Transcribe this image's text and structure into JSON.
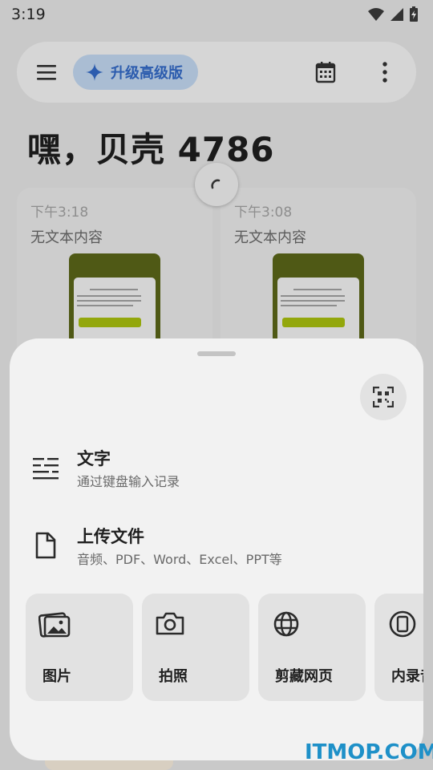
{
  "status_bar": {
    "time": "3:19"
  },
  "top_bar": {
    "upgrade_label": "升级高级版"
  },
  "greeting": "嘿，贝壳 4786",
  "cards": [
    {
      "time": "下午3:18",
      "title": "无文本内容"
    },
    {
      "time": "下午3:08",
      "title": "无文本内容"
    }
  ],
  "sheet": {
    "options": [
      {
        "title": "文字",
        "subtitle": "通过键盘输入记录",
        "icon": "text-lines-icon"
      },
      {
        "title": "上传文件",
        "subtitle": "音频、PDF、Word、Excel、PPT等",
        "icon": "file-icon"
      }
    ],
    "tiles": [
      {
        "label": "图片",
        "icon": "image-icon"
      },
      {
        "label": "拍照",
        "icon": "camera-icon"
      },
      {
        "label": "剪藏网页",
        "icon": "globe-icon"
      },
      {
        "label": "内录音",
        "icon": "phone-record-icon"
      }
    ]
  },
  "watermark": "ITMOP.COM",
  "colors": {
    "accent": "#2c5cae",
    "watermark": "#1e90c8",
    "sheet": "#f2f2f2"
  }
}
